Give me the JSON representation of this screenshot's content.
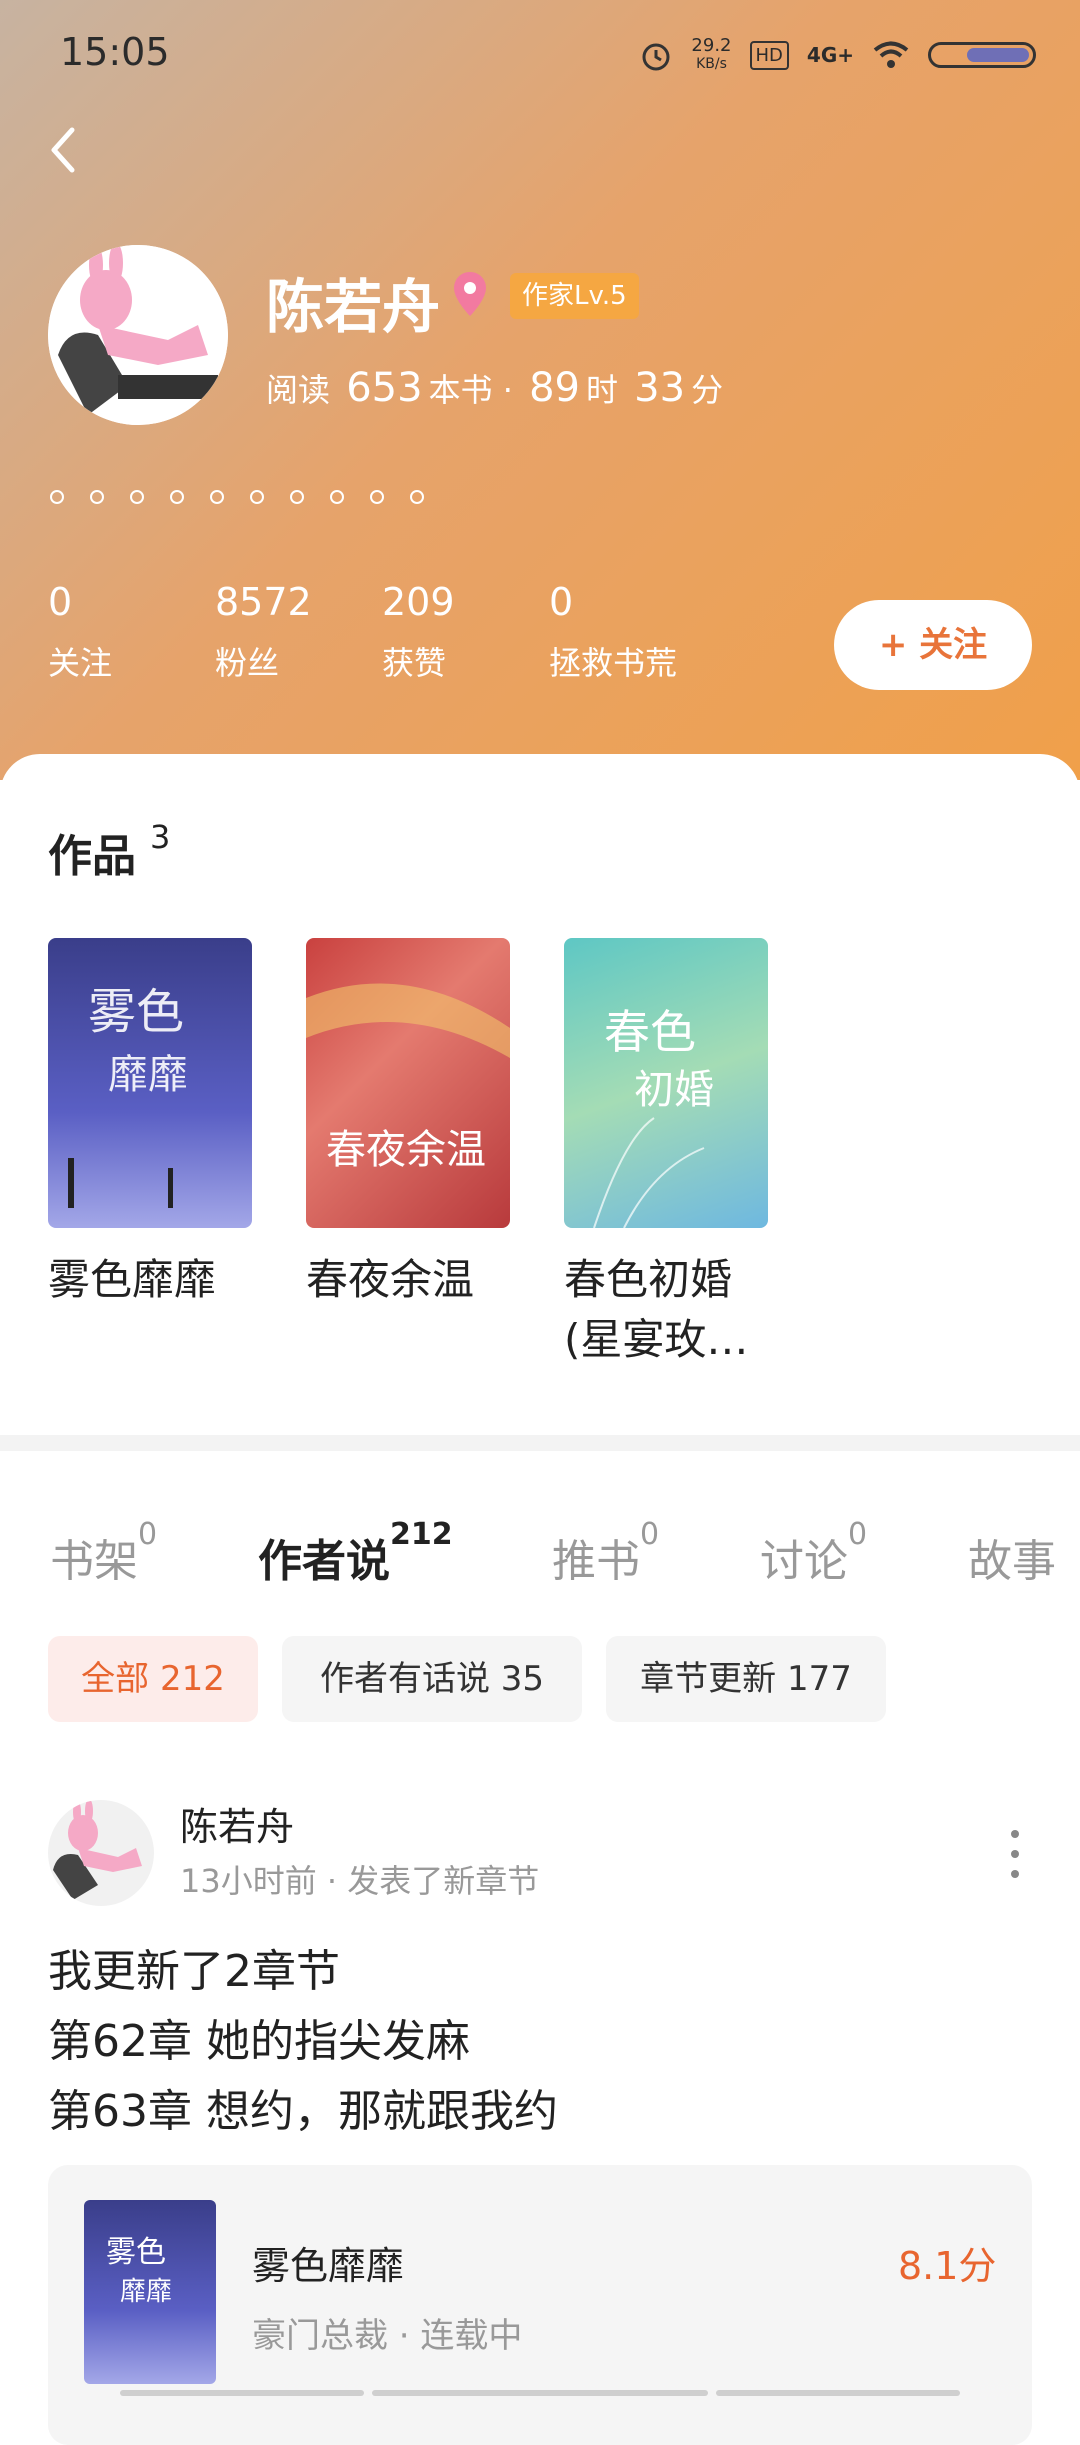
{
  "status_bar": {
    "time": "15:05",
    "net_speed": "29.2",
    "net_unit": "KB/s",
    "hd": "HD",
    "network": "4G+"
  },
  "profile": {
    "name": "陈若舟",
    "level": "作家Lv.5",
    "reading_label": "阅读",
    "books_read": "653",
    "books_unit": "本书 ·",
    "hours": "89",
    "hours_unit": "时",
    "minutes": "33",
    "minutes_unit": "分",
    "bio_dots": 10,
    "stats": [
      {
        "value": "0",
        "label": "关注"
      },
      {
        "value": "8572",
        "label": "粉丝"
      },
      {
        "value": "209",
        "label": "获赞"
      },
      {
        "value": "0",
        "label": "拯救书荒"
      }
    ],
    "follow_button": "+ 关注"
  },
  "works": {
    "title": "作品",
    "count": "3",
    "books": [
      {
        "title": "雾色靡靡"
      },
      {
        "title": "春夜余温"
      },
      {
        "title": "春色初婚(星宴玫…"
      }
    ]
  },
  "tabs": [
    {
      "label": "书架",
      "count": "0",
      "active": false
    },
    {
      "label": "作者说",
      "count": "212",
      "active": true
    },
    {
      "label": "推书",
      "count": "0",
      "active": false
    },
    {
      "label": "讨论",
      "count": "0",
      "active": false
    },
    {
      "label": "故事",
      "count": "",
      "active": false
    }
  ],
  "filters": [
    {
      "label": "全部 212",
      "active": true
    },
    {
      "label": "作者有话说 35",
      "active": false
    },
    {
      "label": "章节更新 177",
      "active": false
    }
  ],
  "post": {
    "author": "陈若舟",
    "meta": "13小时前 · 发表了新章节",
    "lines": [
      "我更新了2章节",
      "第62章 她的指尖发麻",
      "第63章 想约，那就跟我约"
    ],
    "book": {
      "title": "雾色靡靡",
      "score": "8.1分",
      "meta": "豪门总裁 · 连载中"
    }
  },
  "colors": {
    "accent": "#e8652f",
    "header_gradient_start": "#c7b3a1",
    "header_gradient_end": "#f0a04a",
    "level_badge": "#f5a742"
  }
}
